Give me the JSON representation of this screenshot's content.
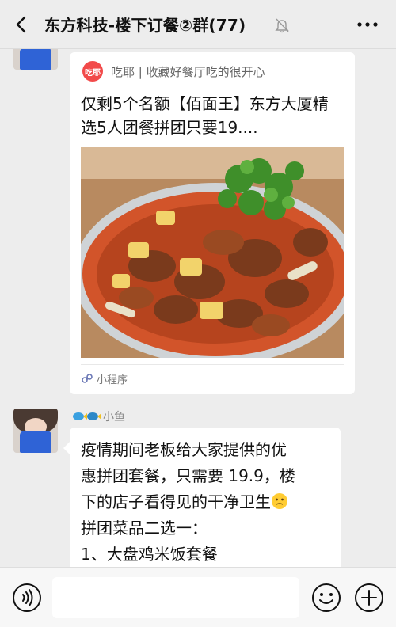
{
  "header": {
    "title": "东方科技-楼下订餐②群(77)"
  },
  "miniprogram": {
    "app_logo_text": "吃耶",
    "app_name": "吃耶 | 收藏好餐厅吃的很开心",
    "title": "仅剩5个名额【佰面王】东方大厦精选5人团餐拼团只要19....",
    "footer_label": "小程序"
  },
  "message": {
    "sender": "小鱼",
    "lines": [
      "疫情期间老板给大家提供的优",
      "惠拼团套餐，只需要 19.9，楼",
      "下的店子看得见的干净卫生",
      "拼团菜品二选一：",
      "1、大盘鸡米饭套餐"
    ]
  },
  "input": {
    "placeholder": ""
  },
  "colors": {
    "background": "#ededed",
    "bubble": "#ffffff",
    "logo_red": "#f24a4a",
    "mask_blue": "#2f63d6"
  },
  "icons": [
    "back-icon",
    "mute-icon",
    "more-icon",
    "voice-icon",
    "emoji-icon",
    "plus-icon",
    "mini-program-icon"
  ]
}
